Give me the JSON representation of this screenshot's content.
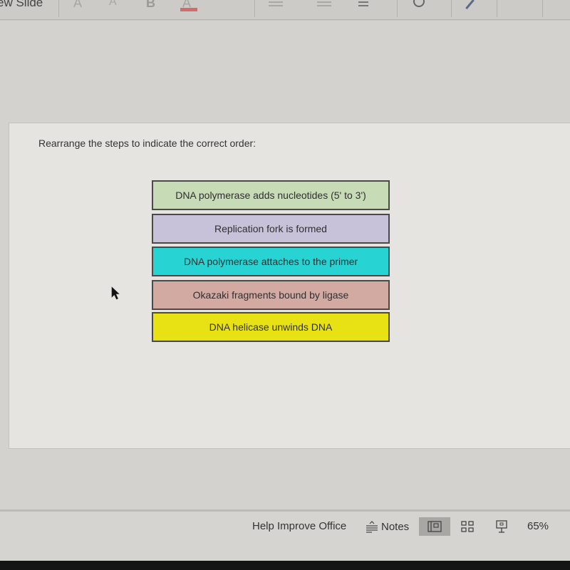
{
  "ribbon": {
    "new_slide_label": "ew Slide",
    "increase_font_glyph": "A",
    "decrease_font_glyph": "A",
    "bold_glyph": "B",
    "font_color_glyph": "A",
    "more_glyph": "•••",
    "more_glyph_2": "•••",
    "chevron_glyph": "∨"
  },
  "slide": {
    "prompt": "Rearrange the steps to indicate the correct order:",
    "steps": [
      {
        "label": "DNA polymerase adds nucleotides (5' to 3')",
        "color": "#c6dbb6"
      },
      {
        "label": "Replication fork is formed",
        "color": "#c7c2d9"
      },
      {
        "label": "DNA polymerase attaches to the primer",
        "color": "#27d3d3"
      },
      {
        "label": "Okazaki fragments bound by ligase",
        "color": "#d3aaa2"
      },
      {
        "label": "DNA helicase unwinds DNA",
        "color": "#e8e214"
      }
    ]
  },
  "statusbar": {
    "help_label": "Help Improve Office",
    "notes_label": "Notes",
    "zoom_level": "65%",
    "active_view": "normal"
  }
}
